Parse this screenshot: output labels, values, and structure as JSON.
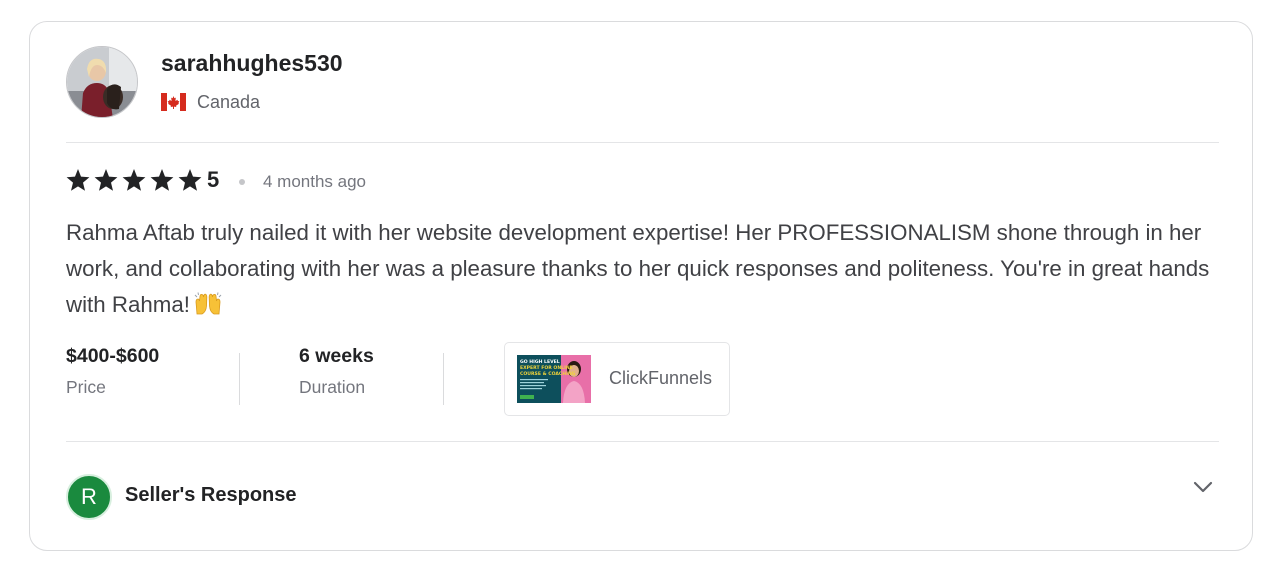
{
  "reviewer": {
    "username": "sarahhughes530",
    "country": "Canada",
    "flag_icon": "canada-flag-icon"
  },
  "rating": {
    "stars": 5,
    "value": "5",
    "time_ago": "4 months ago"
  },
  "review_text": "Rahma Aftab truly nailed it with her website development expertise! Her PROFESSIONALISM shone through in her work, and collaborating with her was a pleasure thanks to her quick responses and politeness. You're in great hands with Rahma!",
  "review_emoji": "raising-hands-emoji",
  "details": {
    "price": {
      "value": "$400-$600",
      "label": "Price"
    },
    "duration": {
      "value": "6 weeks",
      "label": "Duration"
    }
  },
  "portfolio": {
    "label": "ClickFunnels",
    "thumbnail_lines": [
      "GO HIGH LEVEL",
      "EXPERT FOR ONLINE",
      "COURSE & COACHING"
    ]
  },
  "seller_response": {
    "avatar_letter": "R",
    "title": "Seller's Response",
    "avatar_color": "#1a8a3e"
  },
  "colors": {
    "text_dark": "#222325",
    "text_body": "#404145",
    "text_muted": "#74767e",
    "border": "#dadbdd"
  }
}
